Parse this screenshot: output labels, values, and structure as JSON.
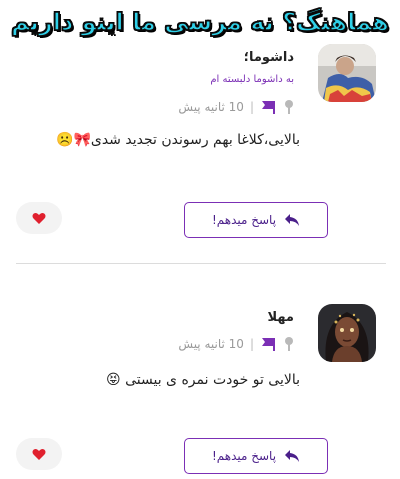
{
  "banner": {
    "caption": "هماهنگ؟ نه مرسی ما اینو داریم"
  },
  "comments": [
    {
      "author": "داشوما؛",
      "note": "به داشوما دلبسته ام",
      "time": "10 ثانیه پیش",
      "separator": "|",
      "text": "بالایی،کلاغا بهم رسوندن تجدید شدی🎀☹️",
      "reply_label": "پاسخ میدهم!"
    },
    {
      "author": "مهلا",
      "time": "10 ثانیه پیش",
      "separator": "|",
      "text": "بالایی تو خودت نمره ی بیستی 😝",
      "reply_label": "پاسخ میدهم!"
    }
  ],
  "colors": {
    "accent": "#7b2fb5",
    "banner_fill": "#2fd0e8",
    "heart": "#e0202e"
  },
  "icons": {
    "reply": "reply-arrow-icon",
    "flag": "flag-icon",
    "pin": "pin-icon",
    "like": "heart-icon"
  }
}
